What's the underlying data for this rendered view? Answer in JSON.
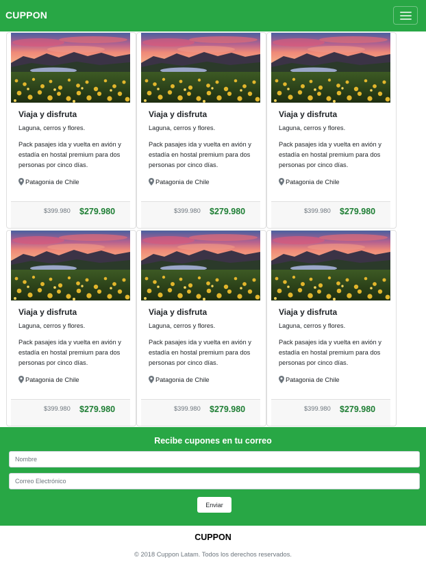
{
  "navbar": {
    "brand": "CUPPON",
    "menu_icon": "hamburger-icon"
  },
  "cards": [
    {
      "title": "Viaja y disfruta",
      "subtitle": "Laguna, cerros y flores.",
      "description": "Pack pasajes ida y vuelta en avión y estadía en hostal premium para dos personas por cinco días.",
      "location": "Patagonia de Chile",
      "old_price": "$399.980",
      "price": "$279.980"
    },
    {
      "title": "Viaja y disfruta",
      "subtitle": "Laguna, cerros y flores.",
      "description": "Pack pasajes ida y vuelta en avión y estadía en hostal premium para dos personas por cinco días.",
      "location": "Patagonia de Chile",
      "old_price": "$399.980",
      "price": "$279.980"
    },
    {
      "title": "Viaja y disfruta",
      "subtitle": "Laguna, cerros y flores.",
      "description": "Pack pasajes ida y vuelta en avión y estadía en hostal premium para dos personas por cinco días.",
      "location": "Patagonia de Chile",
      "old_price": "$399.980",
      "price": "$279.980"
    },
    {
      "title": "Viaja y disfruta",
      "subtitle": "Laguna, cerros y flores.",
      "description": "Pack pasajes ida y vuelta en avión y estadía en hostal premium para dos personas por cinco días.",
      "location": "Patagonia de Chile",
      "old_price": "$399.980",
      "price": "$279.980"
    },
    {
      "title": "Viaja y disfruta",
      "subtitle": "Laguna, cerros y flores.",
      "description": "Pack pasajes ida y vuelta en avión y estadía en hostal premium para dos personas por cinco días.",
      "location": "Patagonia de Chile",
      "old_price": "$399.980",
      "price": "$279.980"
    },
    {
      "title": "Viaja y disfruta",
      "subtitle": "Laguna, cerros y flores.",
      "description": "Pack pasajes ida y vuelta en avión y estadía en hostal premium para dos personas por cinco días.",
      "location": "Patagonia de Chile",
      "old_price": "$399.980",
      "price": "$279.980"
    }
  ],
  "newsletter": {
    "title": "Recibe cupones en tu correo",
    "name_placeholder": "Nombre",
    "email_placeholder": "Correo Electrónico",
    "submit_label": "Enviar"
  },
  "footer": {
    "brand": "CUPPON",
    "copyright": "© 2018 Cuppon Latam. Todos los derechos reservados."
  },
  "colors": {
    "brand_green": "#28a745",
    "price_green": "#1e7e34",
    "muted": "#6c757d"
  }
}
